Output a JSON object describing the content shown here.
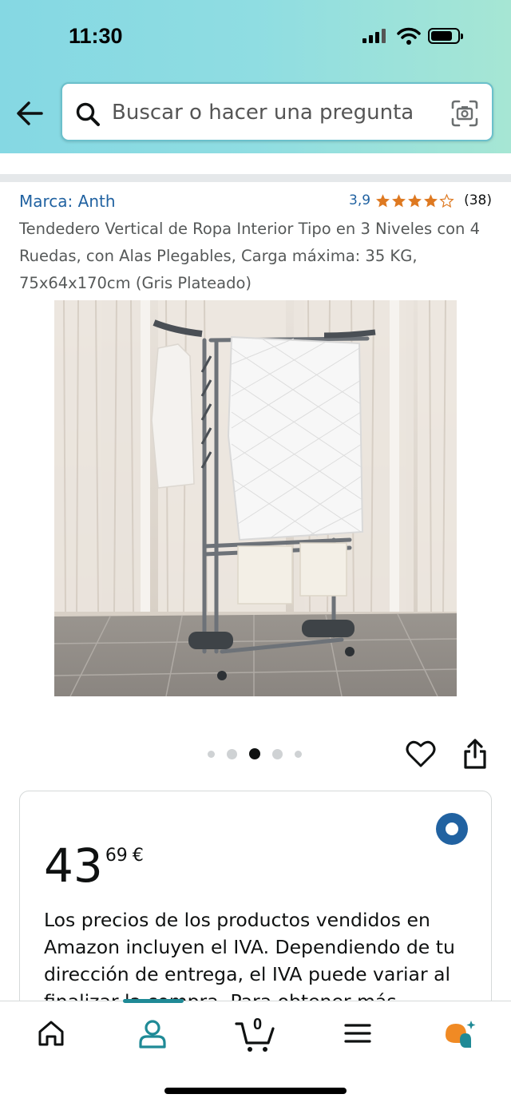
{
  "status_bar": {
    "time": "11:30"
  },
  "search": {
    "placeholder": "Buscar o hacer una pregunta"
  },
  "product": {
    "brand": "Marca: Anth",
    "rating": "3,9",
    "rating_value": 3.9,
    "review_count": "(38)",
    "title": "Tendedero Vertical de Ropa Interior Tipo en 3 Niveles con 4 Ruedas, con Alas Plegables, Carga máxima: 35 KG, 75x64x170cm (Gris Plateado)",
    "image_count": 5,
    "active_image_index": 2
  },
  "price": {
    "whole": "43",
    "fraction": "69",
    "currency": "€",
    "vat_note": "Los precios de los productos vendidos en Amazon incluyen el IVA. Dependiendo de tu dirección de entrega, el IVA puede variar al finalizar la compra. Para obtener más"
  },
  "tab_bar": {
    "active_tab": "account",
    "cart_count": "0",
    "tabs": [
      "home-icon",
      "account-icon",
      "cart-icon",
      "menu-icon",
      "rufus-icon"
    ]
  },
  "colors": {
    "header_gradient_start": "#85d8e3",
    "header_gradient_end": "#a6e6d4",
    "link_blue": "#2162a1",
    "star_orange": "#de7921",
    "accent_teal": "#1f8a96",
    "radio_blue": "#2162a1"
  }
}
